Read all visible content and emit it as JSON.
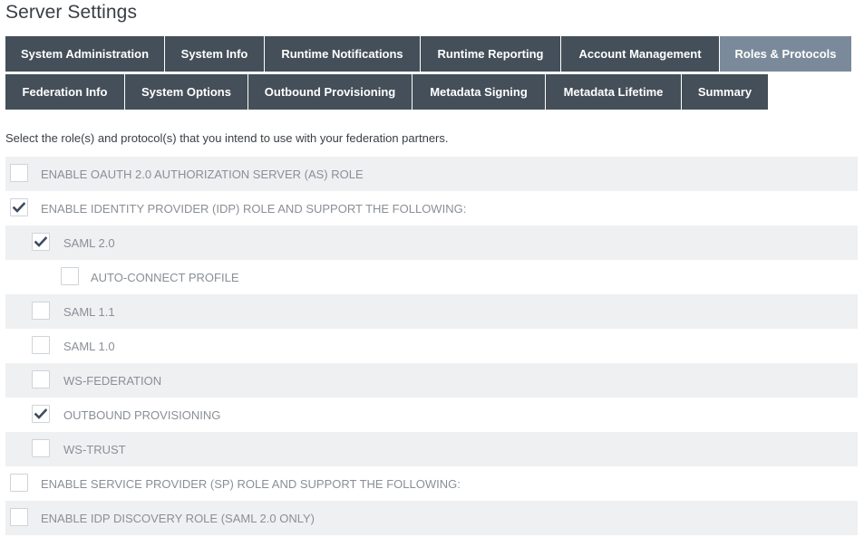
{
  "page": {
    "title": "Server Settings",
    "intro": "Select the role(s) and protocol(s) that you intend to use with your federation partners."
  },
  "tabs": {
    "row1": [
      {
        "label": "System Administration",
        "active": false
      },
      {
        "label": "System Info",
        "active": false
      },
      {
        "label": "Runtime Notifications",
        "active": false
      },
      {
        "label": "Runtime Reporting",
        "active": false
      },
      {
        "label": "Account Management",
        "active": false
      },
      {
        "label": "Roles & Protocols",
        "active": true
      }
    ],
    "row2": [
      {
        "label": "Federation Info",
        "active": false
      },
      {
        "label": "System Options",
        "active": false
      },
      {
        "label": "Outbound Provisioning",
        "active": false
      },
      {
        "label": "Metadata Signing",
        "active": false
      },
      {
        "label": "Metadata Lifetime",
        "active": false
      },
      {
        "label": "Summary",
        "active": false
      }
    ]
  },
  "options": [
    {
      "label": "ENABLE OAUTH 2.0 AUTHORIZATION SERVER (AS) ROLE",
      "checked": false,
      "level": 0
    },
    {
      "label": "ENABLE IDENTITY PROVIDER (IDP) ROLE AND SUPPORT THE FOLLOWING:",
      "checked": true,
      "level": 0
    },
    {
      "label": "SAML 2.0",
      "checked": true,
      "level": 1
    },
    {
      "label": "AUTO-CONNECT PROFILE",
      "checked": false,
      "level": 2
    },
    {
      "label": "SAML 1.1",
      "checked": false,
      "level": 1
    },
    {
      "label": "SAML 1.0",
      "checked": false,
      "level": 1
    },
    {
      "label": "WS-FEDERATION",
      "checked": false,
      "level": 1
    },
    {
      "label": "OUTBOUND PROVISIONING",
      "checked": true,
      "level": 1
    },
    {
      "label": "WS-TRUST",
      "checked": false,
      "level": 1
    },
    {
      "label": "ENABLE SERVICE PROVIDER (SP) ROLE AND SUPPORT THE FOLLOWING:",
      "checked": false,
      "level": 0
    },
    {
      "label": "ENABLE IDP DISCOVERY ROLE (SAML 2.0 ONLY)",
      "checked": false,
      "level": 0
    }
  ],
  "colors": {
    "tab_bg": "#444f59",
    "tab_active_bg": "#7b8a9b",
    "row_shade": "#eff0f2",
    "check_color": "#3d4c60",
    "label_color": "#8a8f96"
  }
}
